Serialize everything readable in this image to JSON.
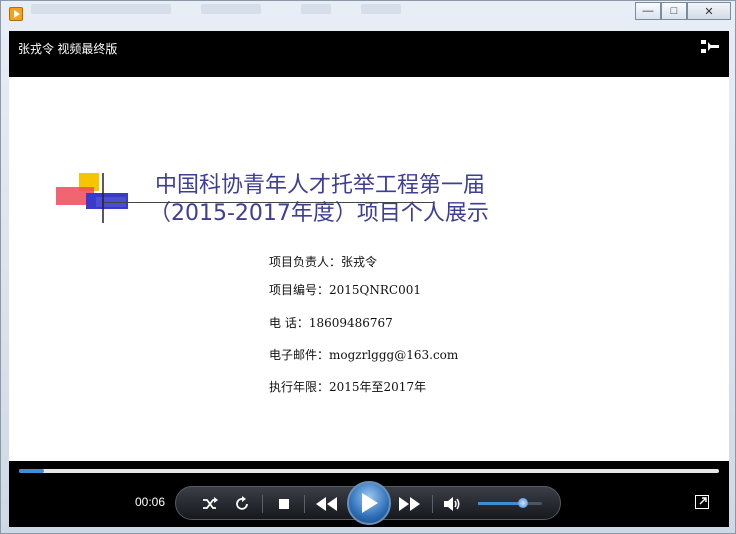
{
  "window": {
    "min_label": "—",
    "max_label": "□",
    "close_label": "✕"
  },
  "player": {
    "video_title": "张戎令  视频最终版",
    "time": "00:06",
    "progress": 0.035,
    "volume": 0.7
  },
  "slide": {
    "title_line1": "中国科协青年人才托举工程第一届",
    "title_line2": "（2015-2017年度）项目个人展示",
    "info": [
      "项目负责人：张戎令",
      "项目编号：2015QNRC001",
      "电    话：18609486767",
      "电子邮件：mogzrlggg@163.com",
      "执行年限：2015年至2017年"
    ]
  },
  "icons": {
    "app": "media-player-icon",
    "playlist": "playlist-toggle-icon",
    "shuffle": "shuffle-icon",
    "repeat": "repeat-icon",
    "stop": "stop-icon",
    "previous": "previous-icon",
    "play": "play-icon",
    "next": "next-icon",
    "volume": "volume-icon",
    "fullscreen": "fullscreen-icon"
  },
  "colors": {
    "slide_title": "#3e3e94",
    "accent": "#3c8ed6"
  }
}
